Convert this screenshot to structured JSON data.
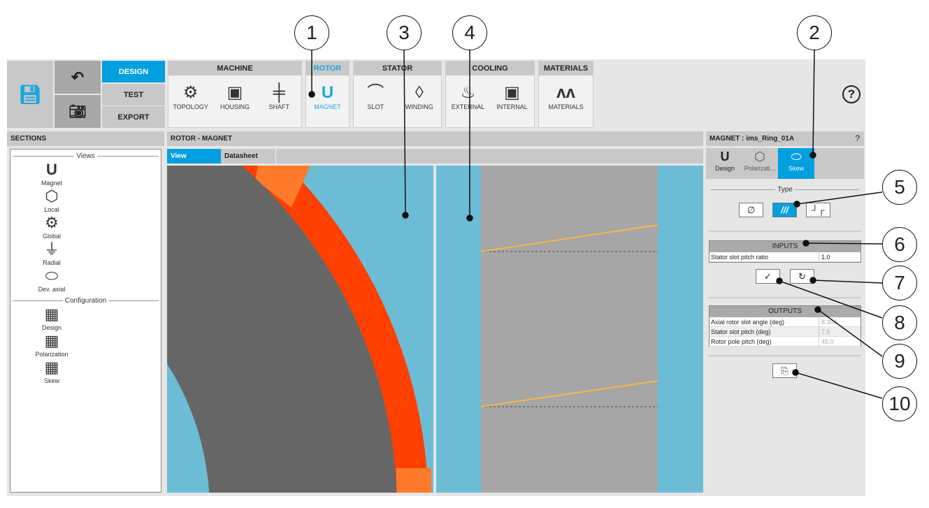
{
  "toolbar": {
    "design": "DESIGN",
    "test": "TEST",
    "export": "EXPORT",
    "groups": [
      {
        "title": "MACHINE",
        "items": [
          "TOPOLOGY",
          "HOUSING",
          "SHAFT"
        ]
      },
      {
        "title": "ROTOR",
        "items": [
          "MAGNET"
        ]
      },
      {
        "title": "STATOR",
        "items": [
          "SLOT",
          "WINDING"
        ]
      },
      {
        "title": "COOLING",
        "items": [
          "EXTERNAL",
          "INTERNAL"
        ]
      },
      {
        "title": "MATERIALS",
        "items": [
          "MATERIALS"
        ]
      }
    ],
    "help": "?"
  },
  "sections": {
    "title": "SECTIONS",
    "views_label": "Views",
    "views": [
      "Magnet",
      "Local",
      "Global",
      "Radial",
      "Dev. axial"
    ],
    "config_label": "Configuration",
    "config": [
      "Design",
      "Polarization",
      "Skew"
    ]
  },
  "center": {
    "title": "ROTOR - MAGNET",
    "tabs": [
      "View",
      "Datasheet"
    ]
  },
  "right": {
    "title": "MAGNET : ims_Ring_01A",
    "help": "?",
    "tabs": [
      "Design",
      "Polarizati...",
      "Skew"
    ],
    "type_label": "Type",
    "inputs_title": "INPUTS",
    "inputs": [
      {
        "label": "Stator slot pitch ratio",
        "value": "1.0"
      }
    ],
    "outputs_title": "OUTPUTS",
    "outputs": [
      {
        "label": "Axial rotor slot angle (deg)",
        "value": "8.304"
      },
      {
        "label": "Stator slot pitch (deg)",
        "value": "7.5"
      },
      {
        "label": "Rotor pole pitch (deg)",
        "value": "45.0"
      }
    ]
  },
  "callouts": [
    "1",
    "2",
    "3",
    "4",
    "5",
    "6",
    "7",
    "8",
    "9",
    "10"
  ],
  "colors": {
    "accent": "#009fdf",
    "view_bg": "#6dbcd6",
    "ring": "#ff4000",
    "ring_end": "#ff7a2a",
    "core": "#666666",
    "skew_line": "#f5b942"
  }
}
